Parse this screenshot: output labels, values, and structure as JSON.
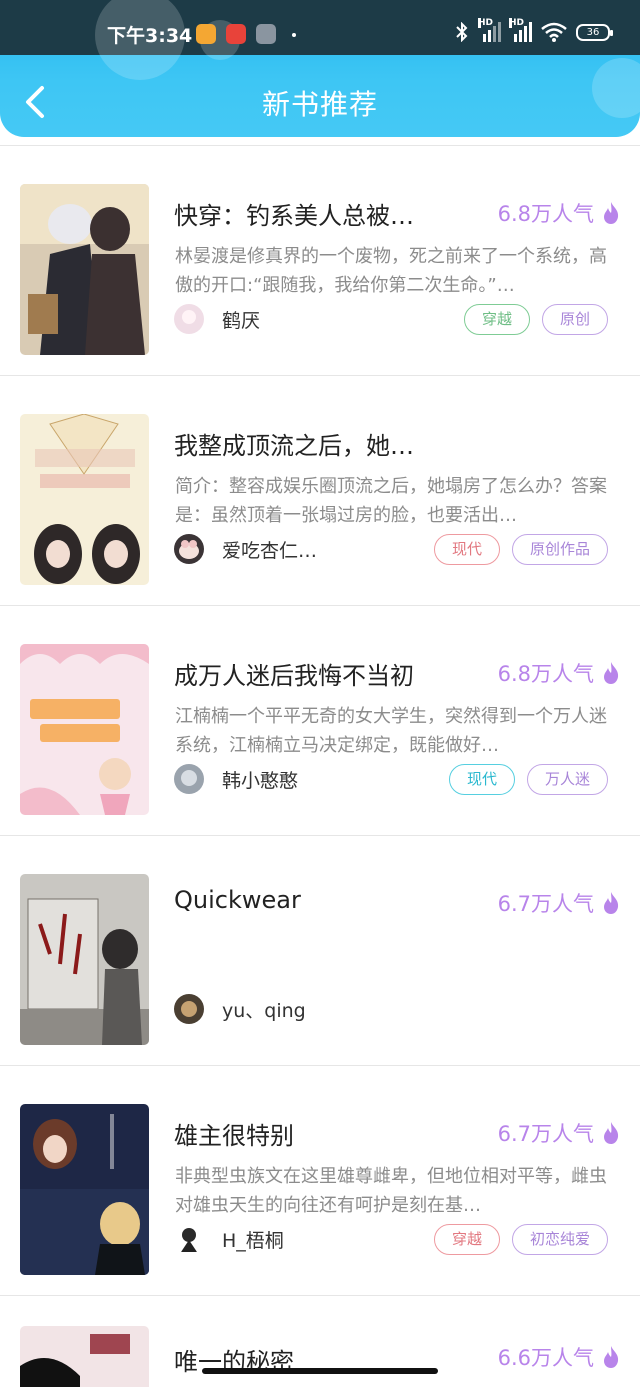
{
  "status": {
    "time": "下午3:34",
    "battery": "36"
  },
  "header": {
    "title": "新书推荐"
  },
  "books": [
    {
      "title": "快穿：钓系美人总被…",
      "popularity": "6.8万人气",
      "desc": "林晏渡是修真界的一个废物，死之前来了一个系统，高傲的开口:“跟随我，我给你第二次生命。”…",
      "author": "鹤厌",
      "tags": [
        "穿越",
        "原创"
      ]
    },
    {
      "title": "我整成顶流之后，她…",
      "popularity": "",
      "desc": "简介：整容成娱乐圈顶流之后，她塌房了怎么办？答案是：虽然顶着一张塌过房的脸，也要活出…",
      "author": "爱吃杏仁…",
      "tags": [
        "现代",
        "原创作品"
      ]
    },
    {
      "title": "成万人迷后我悔不当初",
      "popularity": "6.8万人气",
      "desc": "江楠楠一个平平无奇的女大学生，突然得到一个万人迷系统，江楠楠立马决定绑定，既能做好…",
      "author": "韩小憨憨",
      "tags": [
        "现代",
        "万人迷"
      ]
    },
    {
      "title": "Quickwear",
      "popularity": "6.7万人气",
      "desc": "",
      "author": "yu、qing",
      "tags": []
    },
    {
      "title": "雄主很特别",
      "popularity": "6.7万人气",
      "desc": "非典型虫族文在这里雄尊雌卑，但地位相对平等，雌虫对雄虫天生的向往还有呵护是刻在基…",
      "author": "H_梧桐",
      "tags": [
        "穿越",
        "初恋纯爱"
      ]
    },
    {
      "title": "唯一的秘密",
      "popularity": "6.6万人气",
      "desc": "",
      "author": "",
      "tags": []
    }
  ]
}
